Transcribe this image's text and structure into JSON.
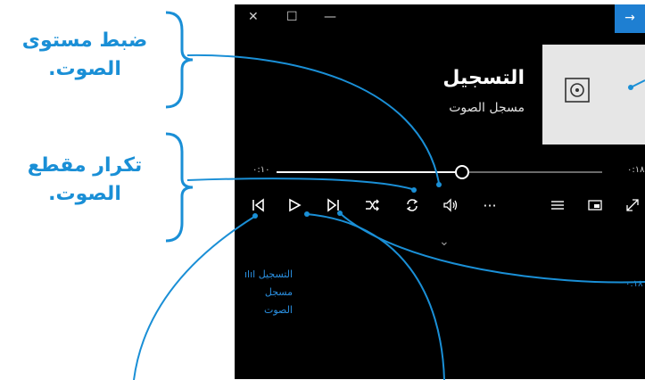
{
  "callouts": {
    "volume": {
      "line1": "ضبط مستوى",
      "line2": "الصوت."
    },
    "repeat": {
      "line1": "تكرار مقطع",
      "line2": "الصوت."
    }
  },
  "window": {
    "close_icon": "close-icon",
    "maximize_icon": "maximize-icon",
    "minimize_icon": "minimize-icon",
    "expand_icon": "arrow-right-icon",
    "close_glyph": "✕",
    "maximize_glyph": "☐",
    "minimize_glyph": "—",
    "expand_glyph": "→"
  },
  "track": {
    "title": "التسجيل",
    "subtitle": "مسجل الصوت",
    "art_icon": "voice-recorder-icon"
  },
  "progress": {
    "elapsed": "٠:١٠",
    "total": "٠:١٨",
    "fraction": 0.57
  },
  "controls": {
    "previous": "previous-icon",
    "play": "play-icon",
    "next": "next-icon",
    "shuffle": "shuffle-icon",
    "repeat": "repeat-icon",
    "volume": "volume-icon",
    "more": "more-icon",
    "more_glyph": "···",
    "playlist": "playlist-icon",
    "miniplayer": "miniplayer-icon",
    "fullscreen": "fullscreen-icon"
  },
  "collapse_glyph": "⌄",
  "mini_player": {
    "title": "التسجيل",
    "subtitle": "مسجل الصوت",
    "time": "٠:١٨"
  },
  "colors": {
    "callout": "#1a8fd6",
    "accent": "#1e7fd2",
    "player_bg": "#000000"
  }
}
